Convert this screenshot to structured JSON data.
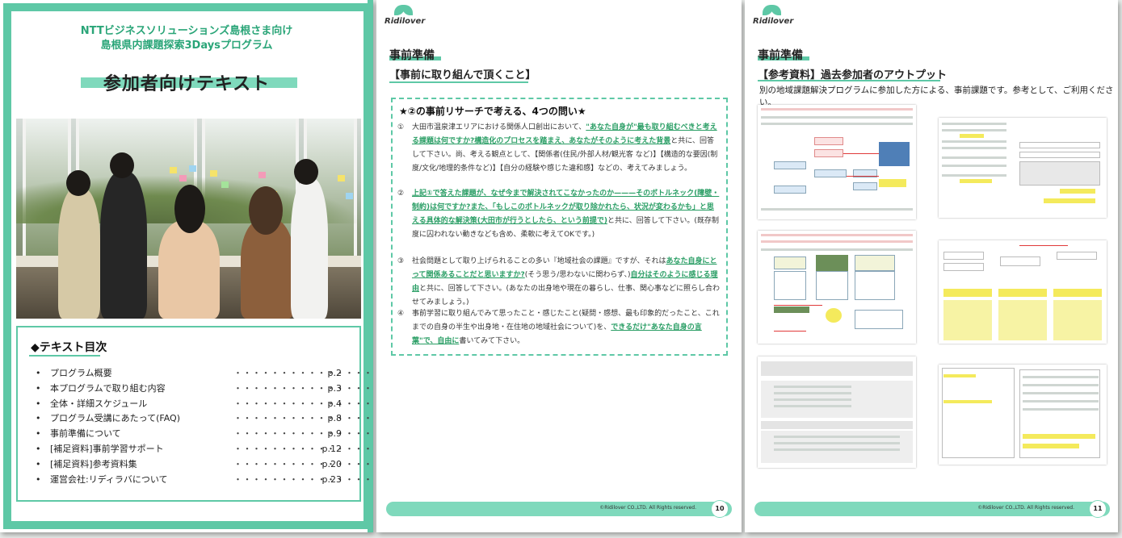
{
  "page1": {
    "subtitle_line1": "NTTビジネスソリューションズ島根さま向け",
    "subtitle_line2": "島根県内課題探索3Daysプログラム",
    "title": "参加者向けテキスト",
    "toc": {
      "heading": "◆テキスト目次",
      "items": [
        {
          "label": "プログラム概要",
          "dots": "・・・・・・・・・・・・・・・・・・・・・・",
          "page": "p.2"
        },
        {
          "label": "本プログラムで取り組む内容",
          "dots": "・・・・・・・・・・・・・・・・・・・・",
          "page": "p.3"
        },
        {
          "label": "全体・詳細スケジュール",
          "dots": "・・・・・・・・・・・・・・・・・・・・・・",
          "page": "p.4"
        },
        {
          "label": "プログラム受講にあたって(FAQ)",
          "dots": "・・・・・・・・・・・・・・・・・・・・・・",
          "page": "p.8"
        },
        {
          "label": "事前準備について",
          "dots": "・・・・・・・・・・・・・・・・・・・・・・",
          "page": "p.9"
        },
        {
          "label": "[補足資料]事前学習サポート",
          "dots": "・・・・・・・・・・・・・・・・・・・・・",
          "page": "p.12"
        },
        {
          "label": "[補足資料]参考資料集",
          "dots": "・・・・・・・・・・・・・・・・・・・・・",
          "page": "p.20"
        },
        {
          "label": "運営会社:リディラバについて",
          "dots": "・・・・・・・・・・・・・・・・・・・・・",
          "page": "p.23"
        }
      ]
    }
  },
  "logo_text": "Ridilover",
  "page2": {
    "section": "事前準備",
    "subheading": "【事前に取り組んで頂くこと】",
    "box_title": "★②の事前リサーチで考える、4つの問い★",
    "q1_num": "①",
    "q1_a": "大田市温泉津エリアにおける関係人口創出において、",
    "q1_hl": "\"あなた自身が\"最も取り組むべきと考える課題は何ですか?構造化のプロセスを踏まえ、あなたがそのように考えた背景",
    "q1_b": "と共に、回答して下さい。尚、考える観点として、【関係者(住民/外部人材/観光客 など)】【構造的な要因(制度/文化/地理的条件など)】【自分の経験や感じた違和感】などの、考えてみましょう。",
    "q2_num": "②",
    "q2_hl": "上記①で答えた課題が、なぜ今まで解決されてこなかったのか———そのボトルネック(障壁・制約)は何ですか?また、「もしこのボトルネックが取り除かれたら、状況が変わるかも」と思える具体的な解決策(大田市が行うとしたら、という前提で)",
    "q2_b": "と共に、回答して下さい。(既存制度に囚われない動きなども含め、柔軟に考えてOKです。)",
    "q3_num": "③",
    "q3_a": "社会問題として取り上げられることの多い『地域社会の課題』ですが、それは",
    "q3_hl": "あなた自身にとって関係あることだと思いますか?",
    "q3_b": "(そう思う/思わないに関わらず、)",
    "q3_hl2": "自分はそのように感じる理由",
    "q3_c": "と共に、回答して下さい。(あなたの出身地や現在の暮らし、仕事、関心事などに照らし合わせてみましょう。)",
    "q4_num": "④",
    "q4_a": "事前学習に取り組んでみて思ったこと・感じたこと(疑問・感想、最も印象的だったこと、これまでの自身の半生や出身地・在住地の地域社会について)を、",
    "q4_hl": "できるだけ\"あなた自身の言葉\"で、自由に",
    "q4_b": "書いてみて下さい。",
    "footer_copy": "©Ridilover CO.,LTD. All Rights reserved.",
    "page_number": "10"
  },
  "page3": {
    "section": "事前準備",
    "subheading": "【参考資料】過去参加者のアウトプット",
    "description": "別の地域課題解決プログラムに参加した方による、事前課題です。参考として、ご利用ください。",
    "footer_copy": "©Ridilover CO.,LTD. All Rights reserved.",
    "page_number": "11"
  },
  "colors": {
    "accent": "#5ec8a6",
    "accent_light": "#7fd9bc",
    "highlight_text": "#2a9e65",
    "title_green": "#2aa578"
  }
}
